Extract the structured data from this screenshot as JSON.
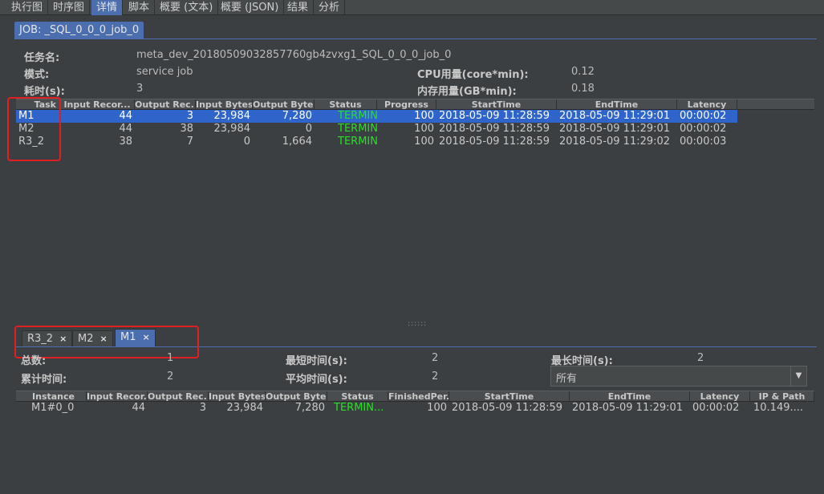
{
  "top_tabs": [
    "执行图",
    "时序图",
    "详情",
    "脚本",
    "概要 (文本)",
    "概要 (JSON)",
    "结果",
    "分析"
  ],
  "top_tab_active": 2,
  "job_tab": "JOB: _SQL_0_0_0_job_0",
  "info": {
    "task_name_label": "任务名:",
    "task_name_value": "meta_dev_20180509032857760gb4zvxg1_SQL_0_0_0_job_0",
    "mode_label": "模式:",
    "mode_value": "service job",
    "duration_label": "耗时(s):",
    "duration_value": "3",
    "cpu_label": "CPU用量(core*min):",
    "cpu_value": "0.12",
    "mem_label": "内存用量(GB*min):",
    "mem_value": "0.18"
  },
  "task_table": {
    "headers": [
      "Task",
      "Input Recor...",
      "Output Rec...",
      "Input Bytes",
      "Output Bytes",
      "Status",
      "Progress",
      "StartTime",
      "EndTime",
      "Latency"
    ],
    "rows": [
      {
        "task": "M1",
        "input_records": "44",
        "output_records": "3",
        "input_bytes": "23,984",
        "output_bytes": "7,280",
        "status": "TERMIN...",
        "progress": "100",
        "start": "2018-05-09 11:28:59",
        "end": "2018-05-09 11:29:01",
        "latency": "00:00:02",
        "selected": true
      },
      {
        "task": "M2",
        "input_records": "44",
        "output_records": "38",
        "input_bytes": "23,984",
        "output_bytes": "0",
        "status": "TERMIN...",
        "progress": "100",
        "start": "2018-05-09 11:28:59",
        "end": "2018-05-09 11:29:01",
        "latency": "00:00:02",
        "selected": false
      },
      {
        "task": "R3_2",
        "input_records": "38",
        "output_records": "7",
        "input_bytes": "0",
        "output_bytes": "1,664",
        "status": "TERMIN...",
        "progress": "100",
        "start": "2018-05-09 11:28:59",
        "end": "2018-05-09 11:29:02",
        "latency": "00:00:03",
        "selected": false
      }
    ]
  },
  "splitter_grip": "::::::",
  "bottom_tabs": [
    {
      "label": "R3_2",
      "close": "×",
      "active": false
    },
    {
      "label": "M2",
      "close": "×",
      "active": false
    },
    {
      "label": "M1",
      "close": "×",
      "active": true
    }
  ],
  "stats": {
    "total_label": "总数:",
    "total_value": "1",
    "min_time_label": "最短时间(s):",
    "min_time_value": "2",
    "max_time_label": "最长时间(s):",
    "max_time_value": "2",
    "cum_time_label": "累计时间:",
    "cum_time_value": "2",
    "avg_time_label": "平均时间(s):",
    "avg_time_value": "2",
    "filter_value": "所有"
  },
  "instance_table": {
    "headers": [
      "Instance",
      "Input Recor...",
      "Output Rec...",
      "Input Bytes",
      "Output Bytes",
      "Status",
      "FinishedPer...",
      "StartTime",
      "EndTime",
      "Latency",
      "IP & Path"
    ],
    "rows": [
      {
        "instance": "M1#0_0",
        "input_records": "44",
        "output_records": "3",
        "input_bytes": "23,984",
        "output_bytes": "7,280",
        "status": "TERMIN...",
        "finished": "100",
        "start": "2018-05-09 11:28:59",
        "end": "2018-05-09 11:29:01",
        "latency": "00:00:02",
        "ip": "10.149...."
      }
    ]
  }
}
